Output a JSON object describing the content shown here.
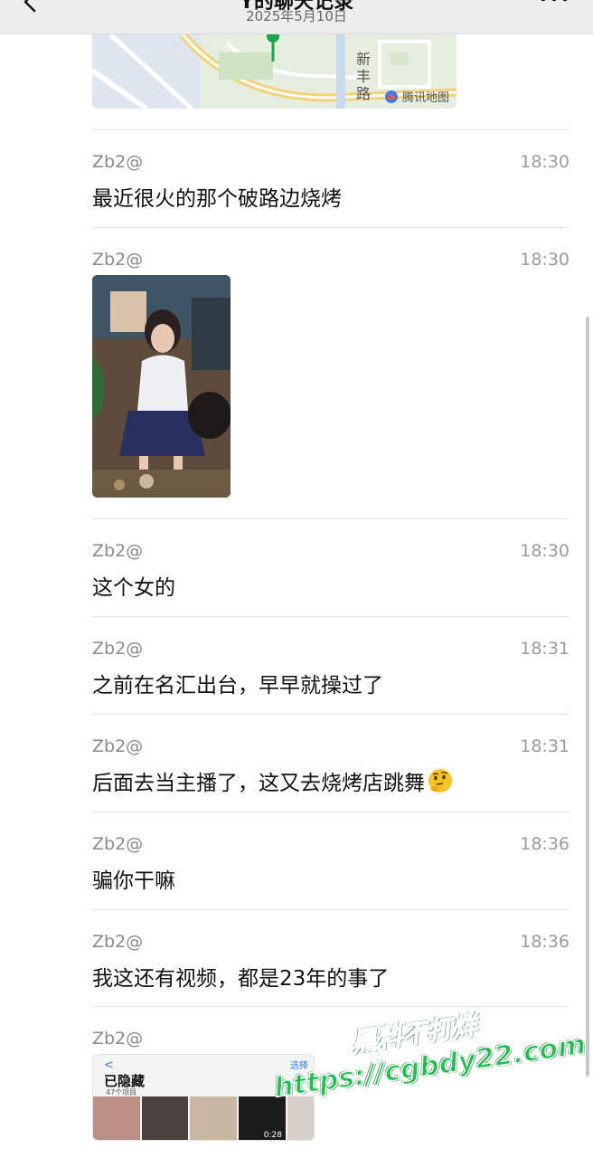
{
  "header": {
    "title": "Y的聊天记录",
    "date": "2025年5月10日",
    "back_icon": "chevron-left-icon",
    "more_icon": "more-dots-icon"
  },
  "map": {
    "road_label": "新丰路",
    "brand": "腾讯地图"
  },
  "messages": [
    {
      "sender": "Zb2@",
      "time": "18:30",
      "type": "text",
      "text": "最近很火的那个破路边烧烤"
    },
    {
      "sender": "Zb2@",
      "time": "18:30",
      "type": "image"
    },
    {
      "sender": "Zb2@",
      "time": "18:30",
      "type": "text",
      "text": "这个女的"
    },
    {
      "sender": "Zb2@",
      "time": "18:31",
      "type": "text",
      "text": "之前在名汇出台，早早就操过了"
    },
    {
      "sender": "Zb2@",
      "time": "18:31",
      "type": "text",
      "text": "后面去当主播了，这又去烧烤店跳舞",
      "emoji": "thinking-face"
    },
    {
      "sender": "Zb2@",
      "time": "18:36",
      "type": "text",
      "text": "骗你干嘛"
    },
    {
      "sender": "Zb2@",
      "time": "18:36",
      "type": "text",
      "text": "我这还有视频，都是23年的事了"
    },
    {
      "sender": "Zb2@",
      "time": "",
      "type": "album"
    }
  ],
  "album": {
    "back": "<",
    "select": "选择",
    "title": "已隐藏",
    "count": "47个项目",
    "video_duration": "0:28"
  },
  "watermark": {
    "line1": "黑料不打烊",
    "line2": "https://cgbdy22.com"
  },
  "colors": {
    "header_bg": "#ededed",
    "watermark_green": "#1fc04e",
    "divider": "#e4e4e4"
  }
}
